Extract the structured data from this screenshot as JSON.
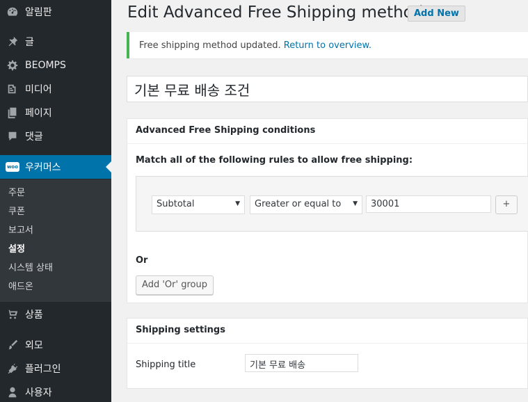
{
  "sidebar": {
    "items": [
      {
        "label": "알림판",
        "icon": "dashboard-icon"
      },
      {
        "label": "글",
        "icon": "pin-icon"
      },
      {
        "label": "BEOMPS",
        "icon": "gear-icon"
      },
      {
        "label": "미디어",
        "icon": "media-icon"
      },
      {
        "label": "페이지",
        "icon": "page-icon"
      },
      {
        "label": "댓글",
        "icon": "comment-icon"
      },
      {
        "label": "우커머스",
        "icon": "woocommerce-icon",
        "badge": "woo"
      },
      {
        "label": "상품",
        "icon": "cart-icon"
      },
      {
        "label": "외모",
        "icon": "brush-icon"
      },
      {
        "label": "플러그인",
        "icon": "plugin-icon"
      },
      {
        "label": "사용자",
        "icon": "user-icon"
      }
    ],
    "submenu": [
      "주문",
      "쿠폰",
      "보고서",
      "설정",
      "시스템 상태",
      "애드온"
    ]
  },
  "header": {
    "title": "Edit Advanced Free Shipping method",
    "add_new_label": "Add New"
  },
  "notice": {
    "text": "Free shipping method updated.",
    "link_text": "Return to overview."
  },
  "method_title": "기본 무료 배송 조건",
  "conditions": {
    "header": "Advanced Free Shipping conditions",
    "match_text": "Match all of the following rules to allow free shipping:",
    "rule": {
      "field": "Subtotal",
      "operator": "Greater or equal to",
      "value": "30001",
      "add_label": "+"
    },
    "or_label": "Or",
    "add_or_label": "Add 'Or' group"
  },
  "settings": {
    "header": "Shipping settings",
    "title_label": "Shipping title",
    "title_value": "기본 무료 배송"
  },
  "colors": {
    "sidebar_bg": "#23282d",
    "active_bg": "#0073aa",
    "notice_border": "#46b450",
    "link": "#0073aa"
  }
}
